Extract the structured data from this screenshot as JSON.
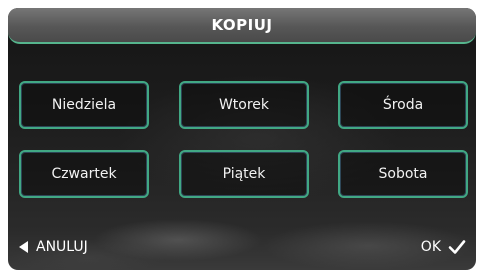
{
  "header": {
    "title": "KOPIUJ"
  },
  "days": [
    {
      "label": "Niedziela"
    },
    {
      "label": "Wtorek"
    },
    {
      "label": "Środa"
    },
    {
      "label": "Czwartek"
    },
    {
      "label": "Piątek"
    },
    {
      "label": "Sobota"
    }
  ],
  "footer": {
    "cancel_label": "ANULUJ",
    "cancel_icon": "back-arrow-icon",
    "ok_label": "OK",
    "ok_icon": "check-icon"
  },
  "colors": {
    "accent": "#41a884",
    "header": "#5e5e5e",
    "background": "#1e1e1e"
  }
}
